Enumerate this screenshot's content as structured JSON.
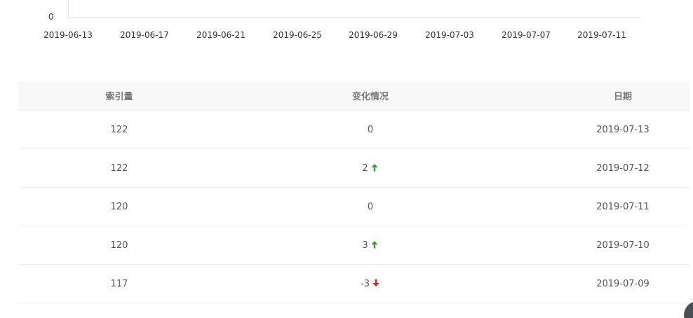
{
  "chart": {
    "y_zero_label": "0",
    "x_ticks": [
      "2019-06-13",
      "2019-06-17",
      "2019-06-21",
      "2019-06-25",
      "2019-06-29",
      "2019-07-03",
      "2019-07-07",
      "2019-07-11"
    ]
  },
  "table": {
    "headers": [
      "索引量",
      "变化情况",
      "日期"
    ],
    "rows": [
      {
        "index": "122",
        "change": "0",
        "trend": "none",
        "date": "2019-07-13"
      },
      {
        "index": "122",
        "change": "2",
        "trend": "up",
        "date": "2019-07-12"
      },
      {
        "index": "120",
        "change": "0",
        "trend": "none",
        "date": "2019-07-11"
      },
      {
        "index": "120",
        "change": "3",
        "trend": "up",
        "date": "2019-07-10"
      },
      {
        "index": "117",
        "change": "-3",
        "trend": "down",
        "date": "2019-07-09"
      }
    ]
  },
  "colors": {
    "up": "#3a9a3a",
    "down": "#e02020"
  },
  "icons": {
    "up": "arrow-up-icon",
    "down": "arrow-down-icon",
    "fab": "floating-action-button"
  }
}
